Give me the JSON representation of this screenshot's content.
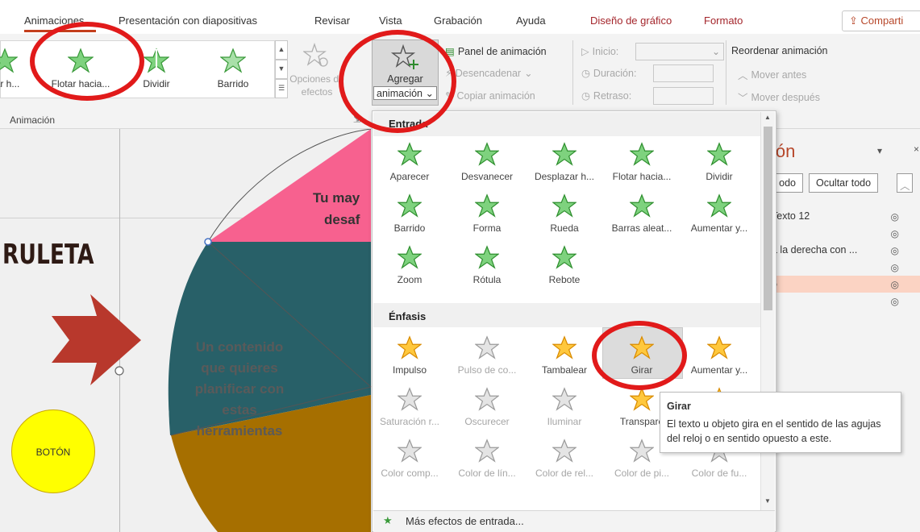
{
  "tabs": [
    "Animaciones",
    "Presentación con diapositivas",
    "Revisar",
    "Vista",
    "Grabación",
    "Ayuda",
    "Diseño de gráfico",
    "Formato"
  ],
  "share_label": "Comparti",
  "ribbon": {
    "gallery": [
      "zar h...",
      "Flotar hacia...",
      "Dividir",
      "Barrido"
    ],
    "effect_options": [
      "Opciones de",
      "efectos"
    ],
    "group_label": "Animación",
    "add_animation": [
      "Agregar",
      "animación"
    ],
    "animation_pane": "Panel de animación",
    "trigger": "Desencadenar",
    "copy_animation": "Copiar animación",
    "start": "Inicio:",
    "duration": "Duración:",
    "delay": "Retraso:",
    "reorder": "Reordenar animación",
    "move_earlier": "Mover antes",
    "move_later": "Mover después"
  },
  "slide": {
    "title": "RULETA",
    "pink_text": [
      "Tu may",
      "desaf"
    ],
    "teal_text": [
      "Un contenido",
      "que quieres",
      "planificar con",
      "estas",
      "herramientas"
    ],
    "button_label": "BOTÓN"
  },
  "menu": {
    "entrada_label": "Entrada",
    "entrada": [
      "Aparecer",
      "Desvanecer",
      "Desplazar h...",
      "Flotar hacia...",
      "Dividir",
      "Barrido",
      "Forma",
      "Rueda",
      "Barras aleat...",
      "Aumentar y...",
      "Zoom",
      "Rótula",
      "Rebote"
    ],
    "enfasis_label": "Énfasis",
    "enfasis": [
      "Impulso",
      "Pulso de co...",
      "Tambalear",
      "Girar",
      "Aumentar y...",
      "Saturación r...",
      "Oscurecer",
      "Iluminar",
      "Transpare",
      "",
      "Color comp...",
      "Color de lín...",
      "Color de rel...",
      "Color de pi...",
      "Color de fu..."
    ],
    "more_effects": "Más efectos de entrada..."
  },
  "tooltip": {
    "title": "Girar",
    "body": "El texto u objeto gira en el sentido de las agujas del reloj o en sentido opuesto a este."
  },
  "pane": {
    "title": "ión",
    "play_all": "odo",
    "hide_all": "Ocultar todo",
    "items": [
      "Texto 12",
      "l",
      "a la derecha con ...",
      "",
      "6",
      ""
    ]
  },
  "colors": {
    "accent": "#c43e1c",
    "highlight": "#e11a1a",
    "pink": "#f7618f",
    "teal": "#286068",
    "gold": "#a66f00",
    "yellow": "#ffff00",
    "arrow": "#b8382c"
  }
}
